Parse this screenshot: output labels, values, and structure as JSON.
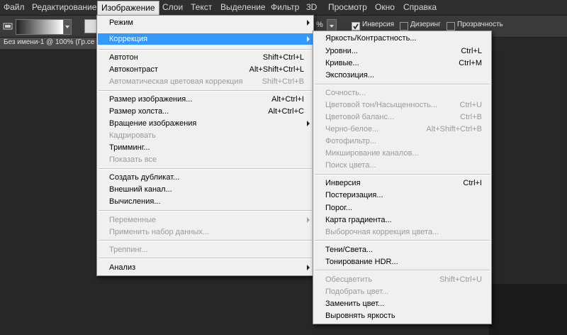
{
  "menubar": {
    "items": [
      "Файл",
      "Редактирование",
      "Изображение",
      "Слои",
      "Текст",
      "Выделение",
      "Фильтр",
      "3D",
      "Просмотр",
      "Окно",
      "Справка"
    ]
  },
  "options": {
    "opacity_value": "%",
    "inverse_label": "Инверсия",
    "dither_label": "Дизеринг",
    "transparency_label": "Прозрачность",
    "inverse_checked": true,
    "dither_checked": false,
    "transparency_checked": false
  },
  "document_tab": {
    "title": "Без имени-1 @ 100% (Гр.се"
  },
  "image_menu": {
    "mode": "Режим",
    "adjustments": "Коррекция",
    "auto_tone": "Автотон",
    "auto_tone_sc": "Shift+Ctrl+L",
    "auto_contrast": "Автоконтраст",
    "auto_contrast_sc": "Alt+Shift+Ctrl+L",
    "auto_color": "Автоматическая цветовая коррекция",
    "auto_color_sc": "Shift+Ctrl+B",
    "image_size": "Размер изображения...",
    "image_size_sc": "Alt+Ctrl+I",
    "canvas_size": "Размер холста...",
    "canvas_size_sc": "Alt+Ctrl+C",
    "rotation": "Вращение изображения",
    "crop": "Кадрировать",
    "trim": "Тримминг...",
    "reveal_all": "Показать все",
    "duplicate": "Создать дубликат...",
    "apply_image": "Внешний канал...",
    "calculations": "Вычисления...",
    "variables": "Переменные",
    "apply_data_set": "Применить набор данных...",
    "trap": "Треппинг...",
    "analysis": "Анализ"
  },
  "adjust_menu": {
    "brightness": "Яркость/Контрастность...",
    "levels": "Уровни...",
    "levels_sc": "Ctrl+L",
    "curves": "Кривые...",
    "curves_sc": "Ctrl+M",
    "exposure": "Экспозиция...",
    "vibrance": "Сочность...",
    "hue_sat": "Цветовой тон/Насыщенность...",
    "hue_sat_sc": "Ctrl+U",
    "color_balance": "Цветовой баланс...",
    "color_balance_sc": "Ctrl+B",
    "bw": "Черно-белое...",
    "bw_sc": "Alt+Shift+Ctrl+B",
    "photo_filter": "Фотофильтр...",
    "channel_mixer": "Микширование каналов...",
    "color_lookup": "Поиск цвета...",
    "invert": "Инверсия",
    "invert_sc": "Ctrl+I",
    "posterize": "Постеризация...",
    "threshold": "Порог...",
    "gradient_map": "Карта градиента...",
    "selective_color": "Выборочная коррекция цвета...",
    "shadows_highlights": "Тени/Света...",
    "hdr_toning": "Тонирование HDR...",
    "desaturate": "Обесцветить",
    "desaturate_sc": "Shift+Ctrl+U",
    "match_color": "Подобрать цвет...",
    "replace_color": "Заменить цвет...",
    "equalize": "Выровнять яркость"
  }
}
